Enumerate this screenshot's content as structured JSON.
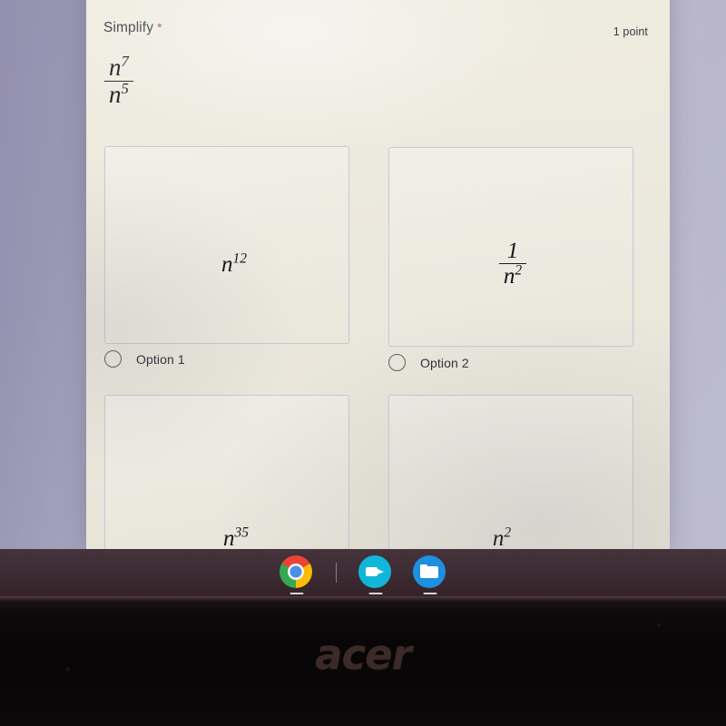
{
  "device": {
    "brand_logo": "acer",
    "shelf": {
      "items": [
        {
          "name": "chrome",
          "label": "Google Chrome",
          "icon": "chrome-icon",
          "active": true
        },
        {
          "name": "camera",
          "label": "Camera",
          "icon": "video-camera-icon",
          "active": true
        },
        {
          "name": "files",
          "label": "Files",
          "icon": "folder-icon",
          "active": true
        }
      ]
    }
  },
  "form": {
    "question": {
      "title": "Simplify",
      "required_marker": "*",
      "points": "1 point",
      "stem": {
        "numerator": "n",
        "numerator_exponent": "7",
        "denominator": "n",
        "denominator_exponent": "5"
      }
    },
    "choices": [
      {
        "id": "option-1",
        "label": "Option 1",
        "selected": false,
        "image": {
          "kind": "power",
          "base": "n",
          "exponent": "12"
        }
      },
      {
        "id": "option-2",
        "label": "Option 2",
        "selected": false,
        "image": {
          "kind": "fraction",
          "numerator": "1",
          "denominator": "n",
          "denominator_exponent": "2"
        }
      },
      {
        "id": "option-3",
        "label": "",
        "selected": false,
        "image": {
          "kind": "power",
          "base": "n",
          "exponent": "35"
        }
      },
      {
        "id": "option-4",
        "label": "",
        "selected": false,
        "image": {
          "kind": "power",
          "base": "n",
          "exponent": "2"
        }
      }
    ]
  },
  "colors": {
    "required_asterisk": "#a43b3f",
    "card_background": "#ece9dd",
    "desktop": "#bcbacf",
    "shelf": "#3e2d35",
    "box_border": "#c3c9d6",
    "text": "#2f3033"
  }
}
